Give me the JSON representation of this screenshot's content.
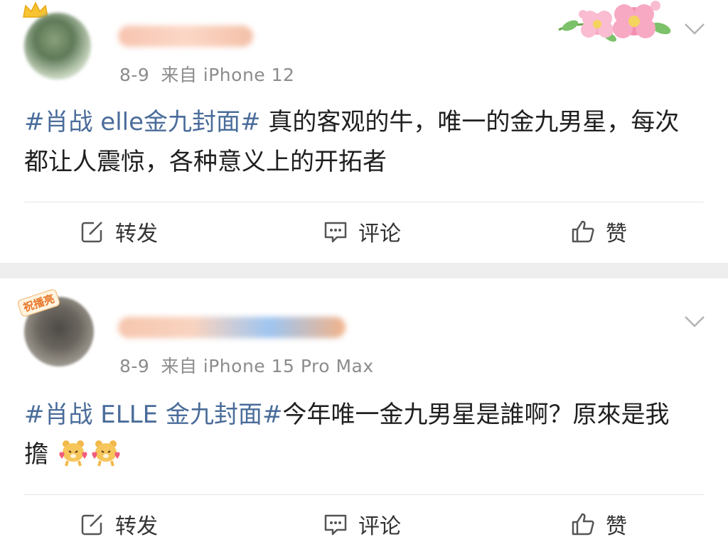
{
  "posts": [
    {
      "date": "8-9",
      "source": "来自 iPhone 12",
      "topic": "#肖战 elle金九封面#",
      "text": " 真的客观的牛，唯一的金九男星，每次都让人震惊，各种意义上的开拓者",
      "actions": {
        "repost": "转发",
        "comment": "评论",
        "like": "赞"
      }
    },
    {
      "date": "8-9",
      "source": "来自 iPhone 15 Pro Max",
      "badge": "祝播亮",
      "topic": "#肖战 ELLE 金九封面#",
      "text": "今年唯一金九男星是誰啊？原來是我擔",
      "actions": {
        "repost": "转发",
        "comment": "评论",
        "like": "赞"
      }
    }
  ],
  "icons": {
    "menu": "chevron-down-icon",
    "repost": "repost-icon",
    "comment": "comment-icon",
    "like": "thumbs-up-icon",
    "flower": "flower-decoration-icon",
    "emoji": "bear-emoji-icon"
  },
  "colors": {
    "topic": "#4a6c9a",
    "meta": "#8c8c8c",
    "separator": "#eeeeee"
  }
}
